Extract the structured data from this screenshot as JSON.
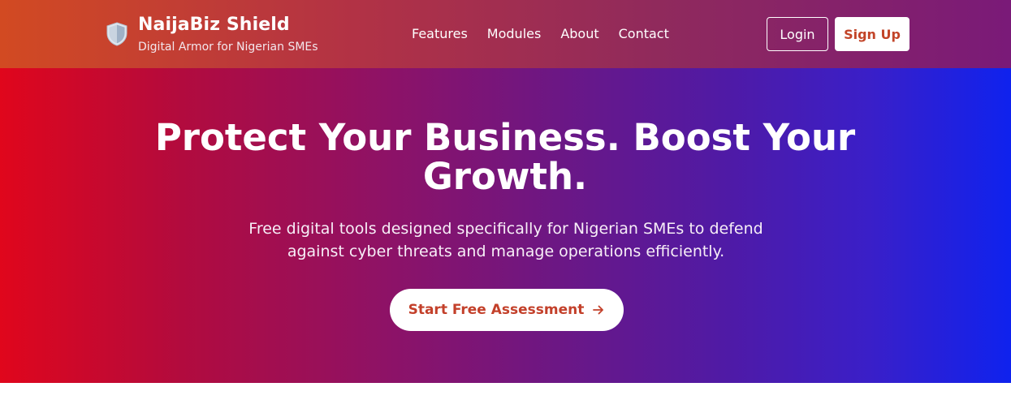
{
  "header": {
    "brand_name": "NaijaBiz Shield",
    "tagline": "Digital Armor for Nigerian SMEs",
    "logo_icon": "shield-icon",
    "nav": [
      {
        "label": "Features"
      },
      {
        "label": "Modules"
      },
      {
        "label": "About"
      },
      {
        "label": "Contact"
      }
    ],
    "login_label": "Login",
    "signup_label": "Sign Up"
  },
  "hero": {
    "title": "Protect Your Business. Boost Your Growth.",
    "subtitle": "Free digital tools designed specifically for Nigerian SMEs to defend against cyber threats and manage operations efficiently.",
    "cta_label": "Start Free Assessment",
    "cta_icon": "arrow-right-icon"
  },
  "colors": {
    "brand_accent": "#c24428",
    "hero_gradient_start": "#e0061c",
    "hero_gradient_end": "#0f22ee",
    "nav_gradient_start": "#d24a22",
    "nav_gradient_end": "#7a1a78"
  }
}
